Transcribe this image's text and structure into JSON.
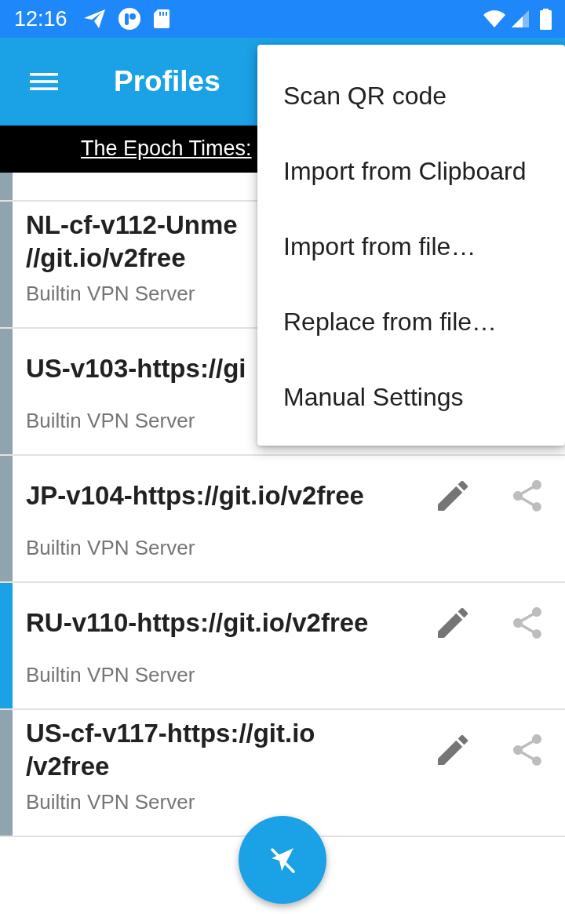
{
  "status_bar": {
    "time": "12:16"
  },
  "toolbar": {
    "title": "Profiles"
  },
  "banner": {
    "link_text": "The Epoch Times:"
  },
  "profiles": [
    {
      "selected": false
    },
    {
      "title": "NL-cf-v112-Unme\n//git.io/v2free",
      "subtitle": "Builtin VPN Server",
      "selected": false
    },
    {
      "title": "US-v103-https://gi",
      "subtitle": "Builtin VPN Server",
      "selected": false
    },
    {
      "title": "JP-v104-https://git.io/v2free",
      "subtitle": "Builtin VPN Server",
      "selected": false
    },
    {
      "title": "RU-v110-https://git.io/v2free",
      "subtitle": "Builtin VPN Server",
      "selected": true
    },
    {
      "title": "US-cf-v117-https://git.io\n/v2free",
      "subtitle": "Builtin VPN Server",
      "selected": false
    }
  ],
  "overflow_menu": {
    "items": [
      "Scan QR code",
      "Import from Clipboard",
      "Import from file…",
      "Replace from file…",
      "Manual Settings"
    ]
  }
}
